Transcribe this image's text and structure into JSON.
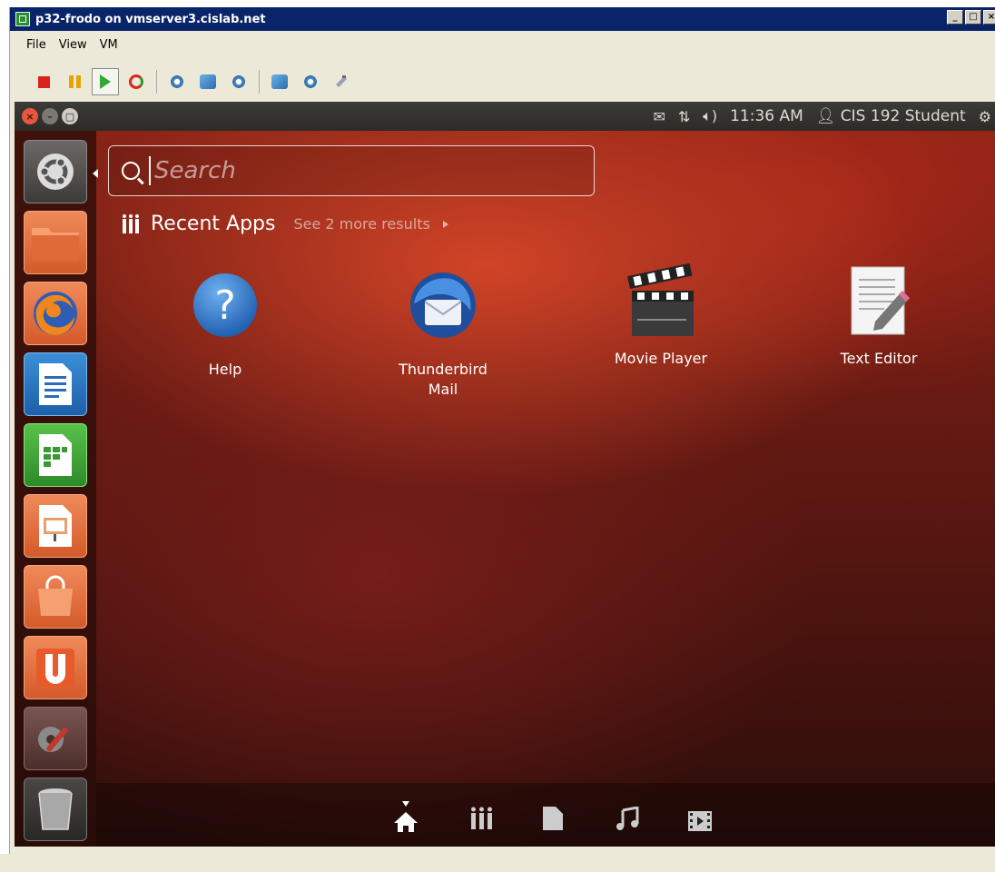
{
  "window": {
    "title": "p32-frodo on vmserver3.cislab.net",
    "controls": [
      "minimize",
      "maximize",
      "close"
    ]
  },
  "menu": [
    "File",
    "View",
    "VM"
  ],
  "toolbar": [
    {
      "name": "power-off",
      "icon": "stop-icon"
    },
    {
      "name": "suspend",
      "icon": "pause-icon"
    },
    {
      "name": "power-on",
      "icon": "play-icon"
    },
    {
      "name": "reset",
      "icon": "refresh-icon"
    },
    {
      "name": "snapshot",
      "icon": "snapshot-icon"
    },
    {
      "name": "revert-snapshot",
      "icon": "revert-icon"
    },
    {
      "name": "snapshot-manager",
      "icon": "snapshot-manager-icon"
    },
    {
      "name": "edit-settings",
      "icon": "edit-settings-icon"
    },
    {
      "name": "cd-dvd",
      "icon": "disc-icon"
    },
    {
      "name": "usb",
      "icon": "usb-icon"
    }
  ],
  "panel": {
    "clock": "11:36 AM",
    "user": "CIS 192 Student"
  },
  "dash": {
    "search_placeholder": "Search",
    "section_title": "Recent Apps",
    "more_results": "See 2 more results",
    "apps": [
      {
        "label": "Help",
        "icon": "help-icon"
      },
      {
        "label": "Thunderbird Mail",
        "icon": "thunderbird-icon"
      },
      {
        "label": "Movie Player",
        "icon": "movie-player-icon"
      },
      {
        "label": "Text Editor",
        "icon": "text-editor-icon"
      }
    ]
  },
  "launcher": [
    {
      "name": "dash-home",
      "icon": "ubuntu-logo-icon"
    },
    {
      "name": "files",
      "icon": "folder-icon"
    },
    {
      "name": "firefox",
      "icon": "firefox-icon"
    },
    {
      "name": "writer",
      "icon": "libreoffice-writer-icon"
    },
    {
      "name": "calc",
      "icon": "libreoffice-calc-icon"
    },
    {
      "name": "impress",
      "icon": "libreoffice-impress-icon"
    },
    {
      "name": "software-center",
      "icon": "shopping-bag-icon"
    },
    {
      "name": "ubuntu-one",
      "icon": "ubuntu-one-icon"
    },
    {
      "name": "system-settings",
      "icon": "settings-icon"
    },
    {
      "name": "trash",
      "icon": "trash-icon"
    }
  ],
  "filters": [
    "home-lens",
    "applications-lens",
    "files-lens",
    "music-lens",
    "video-lens"
  ],
  "colors": {
    "titlebar": "#0a246a",
    "dash_accent": "#d64628",
    "panel": "#3c3b37"
  }
}
